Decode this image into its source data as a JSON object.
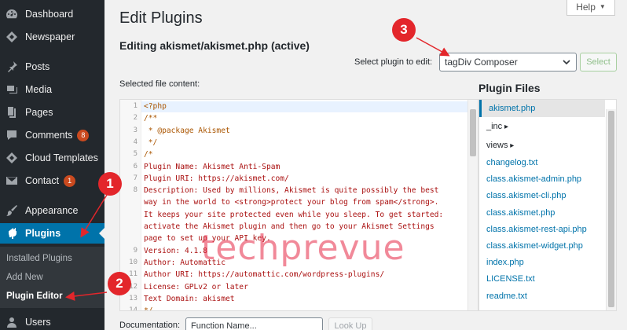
{
  "sidebar": {
    "items": [
      {
        "label": "Dashboard",
        "icon": "dashboard-icon"
      },
      {
        "label": "Newspaper",
        "icon": "newspaper-icon"
      },
      {
        "label": "Posts",
        "icon": "pin-icon"
      },
      {
        "label": "Media",
        "icon": "media-icon"
      },
      {
        "label": "Pages",
        "icon": "pages-icon"
      },
      {
        "label": "Comments",
        "icon": "comments-icon",
        "badge": "8"
      },
      {
        "label": "Cloud Templates",
        "icon": "cloud-icon"
      },
      {
        "label": "Contact",
        "icon": "mail-icon",
        "badge": "1"
      },
      {
        "label": "Appearance",
        "icon": "brush-icon"
      },
      {
        "label": "Plugins",
        "icon": "plugin-icon"
      },
      {
        "label": "Users",
        "icon": "users-icon"
      }
    ],
    "submenu": [
      "Installed Plugins",
      "Add New",
      "Plugin Editor"
    ]
  },
  "header": {
    "title": "Edit Plugins",
    "subtitle": "Editing akismet/akismet.php (active)",
    "help_label": "Help"
  },
  "select_plugin": {
    "label": "Select plugin to edit:",
    "value": "tagDiv Composer",
    "button_label": "Select"
  },
  "editor": {
    "label": "Selected file content:",
    "lines": [
      {
        "num": "1",
        "text": "<?php"
      },
      {
        "num": "2",
        "text": "/**"
      },
      {
        "num": "3",
        "text": " * @package Akismet"
      },
      {
        "num": "4",
        "text": " */"
      },
      {
        "num": "5",
        "text": "/*"
      },
      {
        "num": "6",
        "text": "Plugin Name: Akismet Anti-Spam"
      },
      {
        "num": "7",
        "text": "Plugin URI: https://akismet.com/"
      },
      {
        "num": "8",
        "text": "Description: Used by millions, Akismet is quite possibly the best"
      },
      {
        "num": "",
        "text": "way in the world to <strong>protect your blog from spam</strong>."
      },
      {
        "num": "",
        "text": "It keeps your site protected even while you sleep. To get started:"
      },
      {
        "num": "",
        "text": "activate the Akismet plugin and then go to your Akismet Settings"
      },
      {
        "num": "",
        "text": "page to set up your API key."
      },
      {
        "num": "9",
        "text": "Version: 4.1.8"
      },
      {
        "num": "10",
        "text": "Author: Automattic"
      },
      {
        "num": "11",
        "text": "Author URI: https://automattic.com/wordpress-plugins/"
      },
      {
        "num": "12",
        "text": "License: GPLv2 or later"
      },
      {
        "num": "13",
        "text": "Text Domain: akismet"
      },
      {
        "num": "14",
        "text": "*/"
      }
    ]
  },
  "files": {
    "title": "Plugin Files",
    "items": [
      {
        "name": "akismet.php",
        "type": "current"
      },
      {
        "name": "_inc",
        "type": "dir"
      },
      {
        "name": "views",
        "type": "dir"
      },
      {
        "name": "changelog.txt",
        "type": "file"
      },
      {
        "name": "class.akismet-admin.php",
        "type": "file"
      },
      {
        "name": "class.akismet-cli.php",
        "type": "file"
      },
      {
        "name": "class.akismet.php",
        "type": "file"
      },
      {
        "name": "class.akismet-rest-api.php",
        "type": "file"
      },
      {
        "name": "class.akismet-widget.php",
        "type": "file"
      },
      {
        "name": "index.php",
        "type": "file"
      },
      {
        "name": "LICENSE.txt",
        "type": "file"
      },
      {
        "name": "readme.txt",
        "type": "file"
      }
    ]
  },
  "documentation": {
    "label": "Documentation:",
    "placeholder": "Function Name...",
    "button_label": "Look Up"
  },
  "annotations": [
    "1",
    "2",
    "3"
  ],
  "watermark": "techprevue",
  "colors": {
    "accent": "#0073aa",
    "sidebar": "#23282d",
    "annotation": "#e3262b"
  }
}
